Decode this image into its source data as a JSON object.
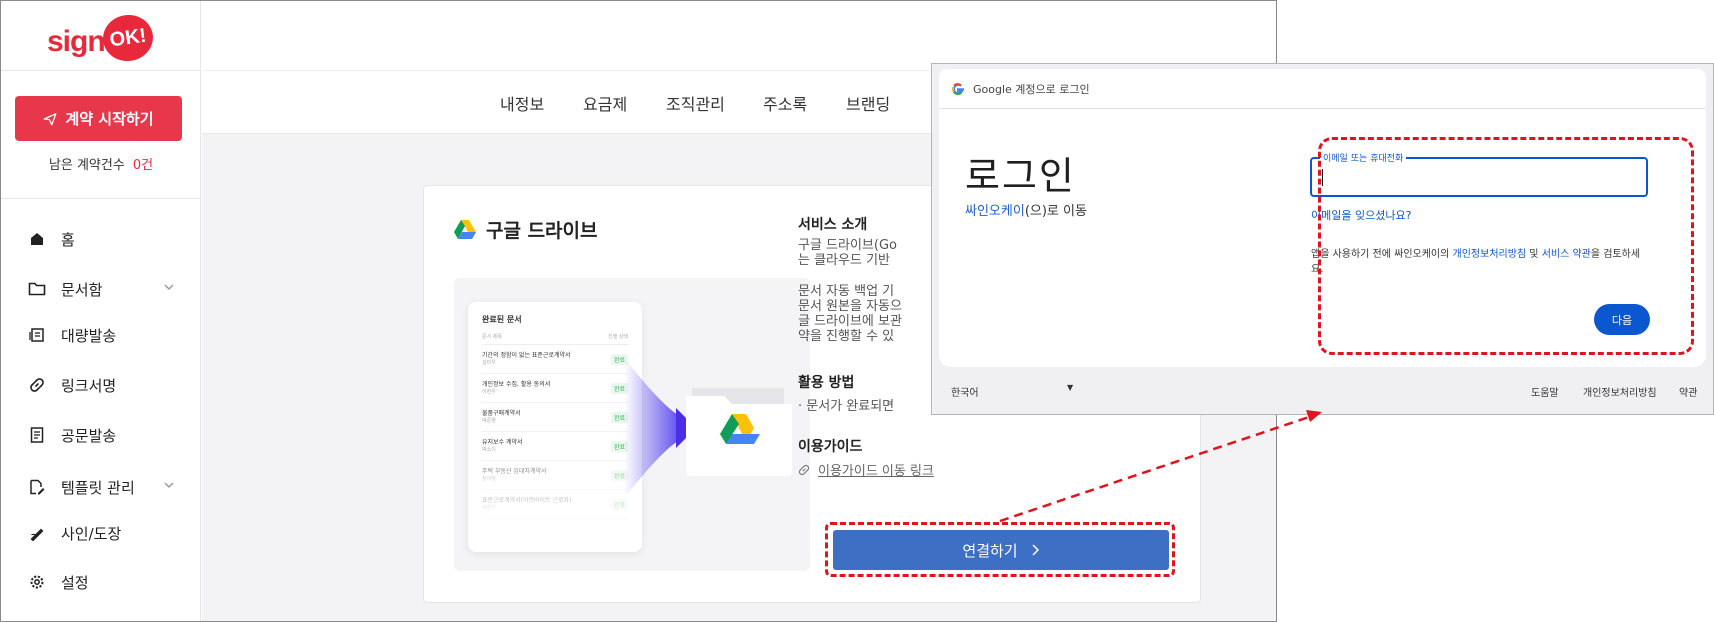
{
  "app": {
    "logo_text": "sign",
    "logo_badge": "OK!"
  },
  "sidebar": {
    "start_button": "계약 시작하기",
    "remaining_label": "남은 계약건수",
    "remaining_count": "0건",
    "items": [
      {
        "label": "홈",
        "icon": "home-icon"
      },
      {
        "label": "문서함",
        "icon": "folder-icon",
        "expandable": true
      },
      {
        "label": "대량발송",
        "icon": "bulk-send-icon"
      },
      {
        "label": "링크서명",
        "icon": "link-icon"
      },
      {
        "label": "공문발송",
        "icon": "document-icon"
      },
      {
        "label": "템플릿 관리",
        "icon": "template-icon",
        "expandable": true
      },
      {
        "label": "사인/도장",
        "icon": "signature-icon"
      },
      {
        "label": "설정",
        "icon": "gear-icon"
      }
    ]
  },
  "topnav": {
    "tabs": [
      "내정보",
      "요금제",
      "조직관리",
      "주소록",
      "브랜딩"
    ]
  },
  "card": {
    "title": "구글 드라이브",
    "illustration": {
      "list_title": "완료된 문서",
      "col_name": "문서 제목",
      "col_status": "진행 상태",
      "rows": [
        {
          "name": "기간의 정함이 없는 표준근로계약서",
          "owner": "김미우",
          "status": "완료"
        },
        {
          "name": "개인정보 수집, 활용 동의서",
          "owner": "이현우",
          "status": "완료"
        },
        {
          "name": "물품구매계약서",
          "owner": "박준영",
          "status": "완료"
        },
        {
          "name": "유지보수 계약서",
          "owner": "박소이",
          "status": "완료"
        },
        {
          "name": "주택 부동산 임대차계약서",
          "owner": "정미정",
          "status": "완료"
        },
        {
          "name": "표준근로계약서(아르바이트 근로자)",
          "owner": "박준혁",
          "status": "완료"
        }
      ]
    },
    "intro_title": "서비스 소개",
    "intro_text_1": "구글 드라이브(Go",
    "intro_text_2": "는 클라우드 기반",
    "intro_text_3": "문서 자동 백업 기",
    "intro_text_4": "문서 원본을 자동으",
    "intro_text_5": "글 드라이브에 보관",
    "intro_text_6": "약을 진행할 수 있",
    "usage_title": "활용 방법",
    "usage_text": "· 문서가 완료되면",
    "guide_title": "이용가이드",
    "guide_link": "이용가이드 이동 링크",
    "connect_button": "연결하기"
  },
  "google": {
    "titlebar": "Google 계정으로 로그인",
    "heading": "로그인",
    "sub_link": "싸인오케이",
    "sub_rest": "(으)로 이동",
    "input_label": "이메일 또는 휴대전화",
    "input_value": "",
    "forgot": "이메일을 잊으셨나요?",
    "notice_1": "앱을 사용하기 전에 싸인오케이의 ",
    "notice_link1": "개인정보처리방침",
    "notice_2": " 및 ",
    "notice_link2": "서비스 약관",
    "notice_3": "을 검토하세요.",
    "next_button": "다음",
    "footer": {
      "language": "한국어",
      "help": "도움말",
      "privacy": "개인정보처리방침",
      "terms": "약관"
    }
  },
  "colors": {
    "brand_red": "#e8293b",
    "connect_blue": "#3d6fc5",
    "google_blue": "#0b57d0",
    "highlight_red": "#e0141c"
  }
}
